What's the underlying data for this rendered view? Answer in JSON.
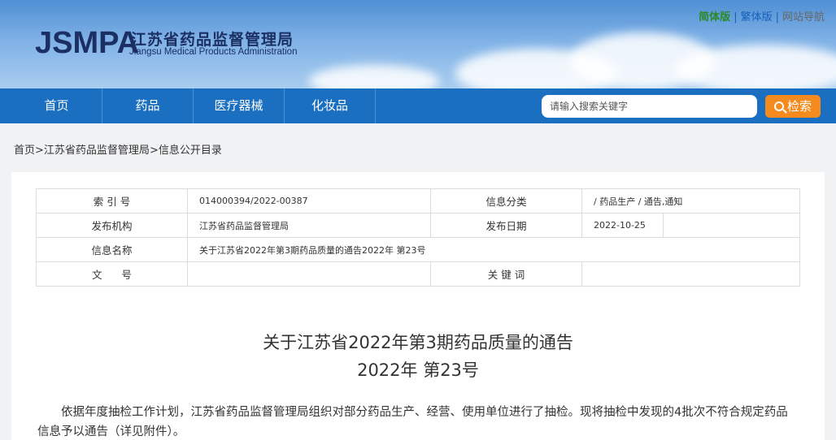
{
  "header": {
    "logo_en": "JSMPA",
    "logo_cn": "江苏省药品监督管理局",
    "logo_sub": "Jiangsu Medical Products Administration",
    "links": {
      "simplified": "简体版",
      "traditional": "繁体版",
      "site_nav": "网站导航",
      "sep": "|"
    }
  },
  "nav": {
    "items": [
      "首页",
      "药品",
      "医疗器械",
      "化妆品"
    ],
    "search_placeholder": "请输入搜索关键字",
    "search_button": "检索"
  },
  "breadcrumb": {
    "home": "首页",
    "org": "江苏省药品监督管理局",
    "dir": "信息公开目录",
    "sep": ">"
  },
  "meta": {
    "index_label": "索 引 号",
    "index_value": "014000394/2022-00387",
    "category_label": "信息分类",
    "category_value": "/   药品生产   /   通告,通知",
    "publisher_label": "发布机构",
    "publisher_value": "江苏省药品监督管理局",
    "date_label": "发布日期",
    "date_value": "2022-10-25",
    "name_label": "信息名称",
    "name_value": "关于江苏省2022年第3期药品质量的通告2022年 第23号",
    "doc_label": "文      号",
    "doc_value": "",
    "keyword_label": "关 键 词",
    "keyword_value": ""
  },
  "article": {
    "title": "关于江苏省2022年第3期药品质量的通告",
    "subtitle": "2022年 第23号",
    "paragraph": "依据年度抽检工作计划，江苏省药品监督管理局组织对部分药品生产、经营、使用单位进行了抽检。现将抽检中发现的4批次不符合规定药品信息予以通告（详见附件）。"
  },
  "colors": {
    "nav_bg": "#1b6fc0",
    "search_btn": "#f58a1f",
    "logo": "#1b2f63"
  }
}
